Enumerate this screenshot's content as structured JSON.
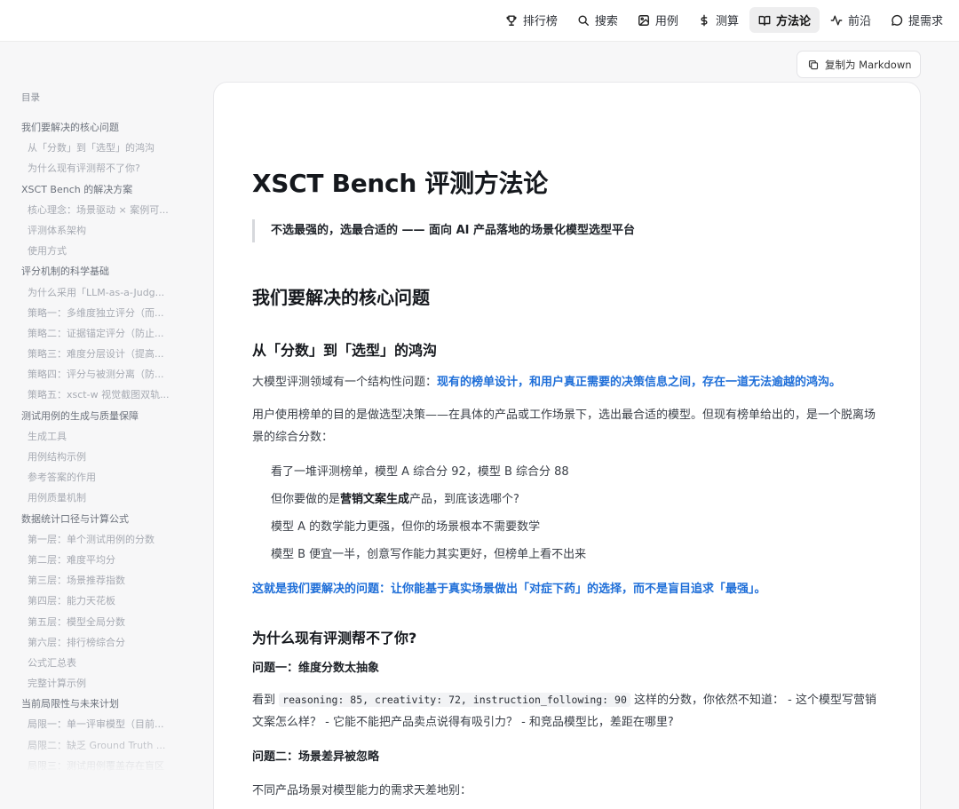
{
  "nav": {
    "items": [
      {
        "label": "排行榜",
        "icon": "trophy-icon"
      },
      {
        "label": "搜索",
        "icon": "search-icon"
      },
      {
        "label": "用例",
        "icon": "image-icon"
      },
      {
        "label": "测算",
        "icon": "dollar-icon"
      },
      {
        "label": "方法论",
        "icon": "book-icon",
        "active": true
      },
      {
        "label": "前沿",
        "icon": "activity-icon"
      },
      {
        "label": "提需求",
        "icon": "message-icon"
      }
    ]
  },
  "toolbar": {
    "copy_label": "复制为 Markdown"
  },
  "toc": {
    "title": "目录",
    "items": [
      {
        "label": "我们要解决的核心问题",
        "level": 1
      },
      {
        "label": "从「分数」到「选型」的鸿沟",
        "level": 2
      },
      {
        "label": "为什么现有评测帮不了你?",
        "level": 2
      },
      {
        "label": "XSCT Bench 的解决方案",
        "level": 1
      },
      {
        "label": "核心理念：场景驱动 × 案例可...",
        "level": 2
      },
      {
        "label": "评测体系架构",
        "level": 2
      },
      {
        "label": "使用方式",
        "level": 2
      },
      {
        "label": "评分机制的科学基础",
        "level": 1
      },
      {
        "label": "为什么采用「LLM-as-a-Judg...",
        "level": 2
      },
      {
        "label": "策略一：多维度独立评分（而...",
        "level": 2
      },
      {
        "label": "策略二：证据锚定评分（防止...",
        "level": 2
      },
      {
        "label": "策略三：难度分层设计（提高...",
        "level": 2
      },
      {
        "label": "策略四：评分与被测分离（防...",
        "level": 2
      },
      {
        "label": "策略五：xsct-w 视觉截图双轨...",
        "level": 2
      },
      {
        "label": "测试用例的生成与质量保障",
        "level": 1
      },
      {
        "label": "生成工具",
        "level": 2
      },
      {
        "label": "用例结构示例",
        "level": 2
      },
      {
        "label": "参考答案的作用",
        "level": 2
      },
      {
        "label": "用例质量机制",
        "level": 2
      },
      {
        "label": "数据统计口径与计算公式",
        "level": 1
      },
      {
        "label": "第一层：单个测试用例的分数",
        "level": 2
      },
      {
        "label": "第二层：难度平均分",
        "level": 2
      },
      {
        "label": "第三层：场景推荐指数",
        "level": 2
      },
      {
        "label": "第四层：能力天花板",
        "level": 2
      },
      {
        "label": "第五层：模型全局分数",
        "level": 2
      },
      {
        "label": "第六层：排行榜综合分",
        "level": 2
      },
      {
        "label": "公式汇总表",
        "level": 2
      },
      {
        "label": "完整计算示例",
        "level": 2
      },
      {
        "label": "当前局限性与未来计划",
        "level": 1
      },
      {
        "label": "局限一：单一评审模型（目前...",
        "level": 2
      },
      {
        "label": "局限二：缺乏 Ground Truth ...",
        "level": 2
      },
      {
        "label": "局限三：测试用例覆盖存在盲区",
        "level": 2
      }
    ]
  },
  "doc": {
    "title": "XSCT Bench 评测方法论",
    "tagline": "不选最强的，选最合适的 —— 面向 AI 产品落地的场景化模型选型平台",
    "section1": "我们要解决的核心问题",
    "sub1": "从「分数」到「选型」的鸿沟",
    "p1_plain": "大模型评测领域有一个结构性问题：",
    "p1_blue": "现有的榜单设计，和用户真正需要的决策信息之间，存在一道无法逾越的鸿沟。",
    "p2": "用户使用榜单的目的是做选型决策——在具体的产品或工作场景下，选出最合适的模型。但现有榜单给出的，是一个脱离场景的综合分数：",
    "li1": "看了一堆评测榜单，模型 A 综合分 92，模型 B 综合分 88",
    "li2_a": "但你要做的是",
    "li2_b": "营销文案生成",
    "li2_c": "产品，到底该选哪个?",
    "li3": "模型 A 的数学能力更强，但你的场景根本不需要数学",
    "li4": "模型 B 便宜一半，创意写作能力其实更好，但榜单上看不出来",
    "conclusion": "这就是我们要解决的问题：让你能基于真实场景做出「对症下药」的选择，而不是盲目追求「最强」。",
    "sub2": "为什么现有评测帮不了你?",
    "q1": "问题一：维度分数太抽象",
    "q1_a": "看到 ",
    "q1_code": "reasoning: 85, creativity: 72, instruction_following: 90",
    "q1_b": " 这样的分数，你依然不知道： - 这个模型写营销文案怎么样？ - 它能不能把产品卖点说得有吸引力？ - 和竞品模型比，差距在哪里?",
    "q2": "问题二：场景差异被忽略",
    "q2_p": "不同产品场景对模型能力的需求天差地别："
  }
}
